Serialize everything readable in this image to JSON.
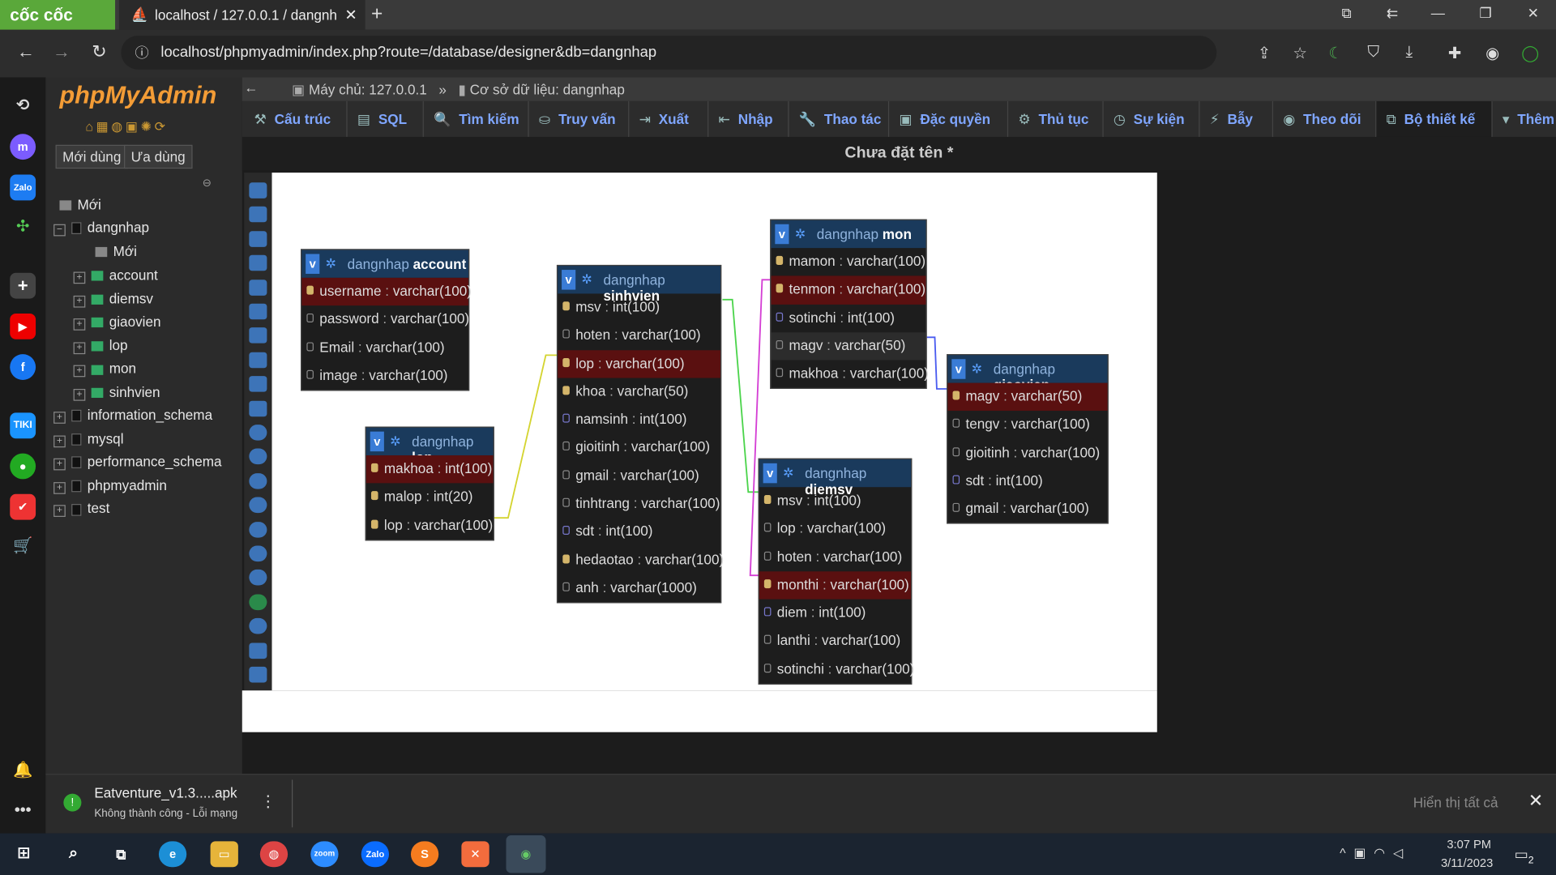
{
  "browser": {
    "brand": "cốc cốc",
    "tab_title": "localhost / 127.0.0.1 / dangnh",
    "url": "localhost/phpmyadmin/index.php?route=/database/designer&db=dangnhap"
  },
  "pma": {
    "logo_php": "php",
    "logo_myadmin": "MyAdmin",
    "recent_btn": "Mới dùng",
    "fav_btn": "Ưa dùng",
    "tree": {
      "new": "Mới",
      "db_name": "dangnhap",
      "db_new": "Mới",
      "tables": [
        "account",
        "diemsv",
        "giaovien",
        "lop",
        "mon",
        "sinhvien"
      ],
      "other_dbs": [
        "information_schema",
        "mysql",
        "performance_schema",
        "phpmyadmin",
        "test"
      ]
    },
    "breadcrumb": {
      "server": "Máy chủ: 127.0.0.1",
      "sep": "»",
      "db": "Cơ sở dữ liệu: dangnhap"
    },
    "menu": [
      "Cấu trúc",
      "SQL",
      "Tìm kiếm",
      "Truy vấn",
      "Xuất",
      "Nhập",
      "Thao tác",
      "Đặc quyền",
      "Thủ tục",
      "Sự kiện",
      "Bẫy",
      "Theo dõi",
      "Bộ thiết kế",
      "Thêm"
    ],
    "page_title": "Chưa đặt tên *"
  },
  "designer": {
    "tables": [
      {
        "db": "dangnhap",
        "name": "account",
        "cols": [
          [
            "username",
            "varchar(100)",
            "pk"
          ],
          [
            "password",
            "varchar(100)",
            ""
          ],
          [
            "Email",
            "varchar(100)",
            ""
          ],
          [
            "image",
            "varchar(100)",
            ""
          ]
        ]
      },
      {
        "db": "dangnhap",
        "name": "lop",
        "cols": [
          [
            "makhoa",
            "int(100)",
            "pk"
          ],
          [
            "malop",
            "int(20)",
            "key"
          ],
          [
            "lop",
            "varchar(100)",
            "key"
          ]
        ]
      },
      {
        "db": "dangnhap",
        "name": "sinhvien",
        "cols": [
          [
            "msv",
            "int(100)",
            "key"
          ],
          [
            "hoten",
            "varchar(100)",
            ""
          ],
          [
            "lop",
            "varchar(100)",
            "pkkey"
          ],
          [
            "khoa",
            "varchar(50)",
            "key"
          ],
          [
            "namsinh",
            "int(100)",
            "num"
          ],
          [
            "gioitinh",
            "varchar(100)",
            ""
          ],
          [
            "gmail",
            "varchar(100)",
            ""
          ],
          [
            "tinhtrang",
            "varchar(100)",
            ""
          ],
          [
            "sdt",
            "int(100)",
            "num"
          ],
          [
            "hedaotao",
            "varchar(100)",
            "key"
          ],
          [
            "anh",
            "varchar(1000)",
            ""
          ]
        ]
      },
      {
        "db": "dangnhap",
        "name": "mon",
        "cols": [
          [
            "mamon",
            "varchar(100)",
            "key"
          ],
          [
            "tenmon",
            "varchar(100)",
            "pk"
          ],
          [
            "sotinchi",
            "int(100)",
            "num"
          ],
          [
            "magv",
            "varchar(50)",
            "hi"
          ],
          [
            "makhoa",
            "varchar(100)",
            ""
          ]
        ]
      },
      {
        "db": "dangnhap",
        "name": "diemsv",
        "cols": [
          [
            "msv",
            "int(100)",
            "key"
          ],
          [
            "lop",
            "varchar(100)",
            ""
          ],
          [
            "hoten",
            "varchar(100)",
            ""
          ],
          [
            "monthi",
            "varchar(100)",
            "pk"
          ],
          [
            "diem",
            "int(100)",
            "num"
          ],
          [
            "lanthi",
            "varchar(100)",
            ""
          ],
          [
            "sotinchi",
            "varchar(100)",
            ""
          ]
        ]
      },
      {
        "db": "dangnhap",
        "name": "giaovien",
        "cols": [
          [
            "magv",
            "varchar(50)",
            "pk"
          ],
          [
            "tengv",
            "varchar(100)",
            ""
          ],
          [
            "gioitinh",
            "varchar(100)",
            ""
          ],
          [
            "sdt",
            "int(100)",
            "num"
          ],
          [
            "gmail",
            "varchar(100)",
            ""
          ]
        ]
      }
    ]
  },
  "download": {
    "file": "Eatventure_v1.3.....apk",
    "status": "Không thành công - Lỗi mạng",
    "show_all": "Hiển thị tất cả"
  },
  "taskbar": {
    "time": "3:07 PM",
    "date": "3/11/2023",
    "notif_count": "2"
  },
  "colors": {
    "brand_green": "#5aa83a",
    "pk_row": "#5a1010",
    "table_head": "#1a3a5c",
    "link_blue": "#7fa6ff"
  }
}
